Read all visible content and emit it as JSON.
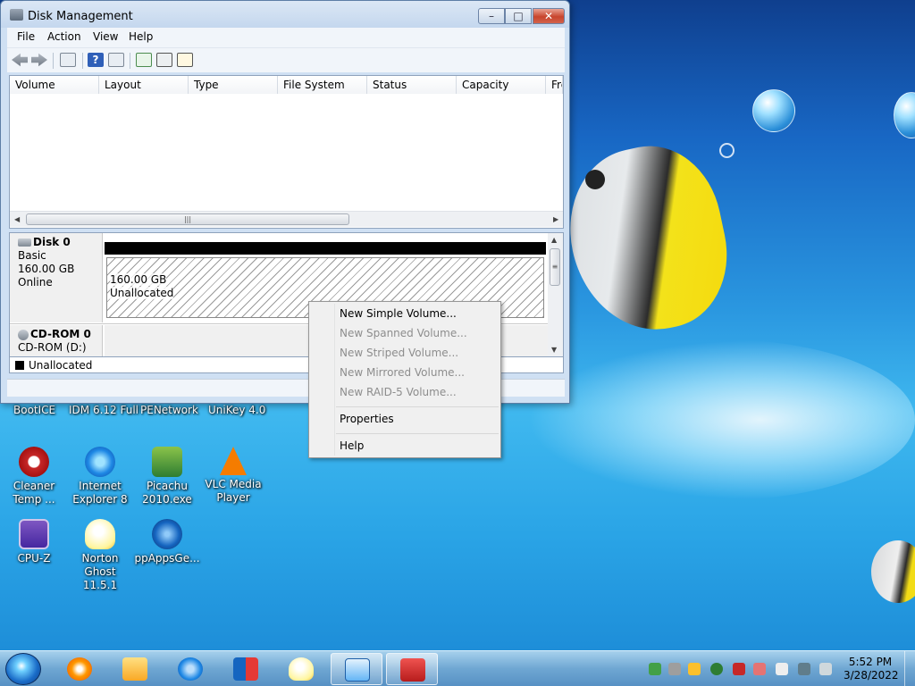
{
  "window": {
    "title": "Disk Management",
    "controls": {
      "minimize": "–",
      "maximize": "□",
      "close": "✕"
    }
  },
  "menu": [
    "File",
    "Action",
    "View",
    "Help"
  ],
  "toolbar_icons": [
    "back-arrow-icon",
    "forward-arrow-icon",
    "console-tree-icon",
    "help-icon",
    "show-pane-icon",
    "refresh-icon",
    "properties-icon",
    "settings-icon"
  ],
  "volume_list": {
    "columns": [
      "Volume",
      "Layout",
      "Type",
      "File System",
      "Status",
      "Capacity",
      "Fre"
    ],
    "rows": []
  },
  "disks": [
    {
      "name": "Disk 0",
      "type": "Basic",
      "size": "160.00 GB",
      "state": "Online",
      "partition": {
        "size": "160.00 GB",
        "label": "Unallocated"
      }
    },
    {
      "name": "CD-ROM 0",
      "type": "CD-ROM (D:)"
    }
  ],
  "legend": {
    "label": "Unallocated",
    "color": "#000000"
  },
  "context_menu": {
    "items": [
      {
        "label": "New Simple Volume...",
        "enabled": true
      },
      {
        "label": "New Spanned Volume...",
        "enabled": false
      },
      {
        "label": "New Striped Volume...",
        "enabled": false
      },
      {
        "label": "New Mirrored Volume...",
        "enabled": false
      },
      {
        "label": "New RAID-5 Volume...",
        "enabled": false
      },
      {
        "label": "Properties",
        "enabled": true
      },
      {
        "label": "Help",
        "enabled": true
      }
    ]
  },
  "desktop": {
    "partial_labels": [
      "BootICE",
      "IDM 6.12 Full",
      "PENetwork",
      "UniKey 4.0"
    ],
    "icons": [
      {
        "label1": "Cleaner",
        "label2": "Temp ...",
        "color": "#c62828"
      },
      {
        "label1": "Internet",
        "label2": "Explorer 8",
        "color": "#1e88e5"
      },
      {
        "label1": "Picachu",
        "label2": "2010.exe",
        "color": "#43a047"
      },
      {
        "label1": "VLC Media",
        "label2": "Player",
        "color": "#f57c00"
      },
      {
        "label1": "CPU-Z",
        "label2": "",
        "color": "#5e35b1"
      },
      {
        "label1": "Norton",
        "label2": "Ghost 11.5.1",
        "color": "#fff59d"
      },
      {
        "label1": "ppAppsGe...",
        "label2": "",
        "color": "#1565c0"
      }
    ]
  },
  "taskbar": {
    "apps": [
      "media-player-icon",
      "explorer-folder-icon",
      "internet-explorer-icon",
      "unikey-icon",
      "norton-ghost-icon",
      "disk-management-icon",
      "toolbox-icon"
    ],
    "active_app": "disk-management-icon",
    "clock": {
      "time": "5:52 PM",
      "date": "3/28/2022"
    }
  }
}
